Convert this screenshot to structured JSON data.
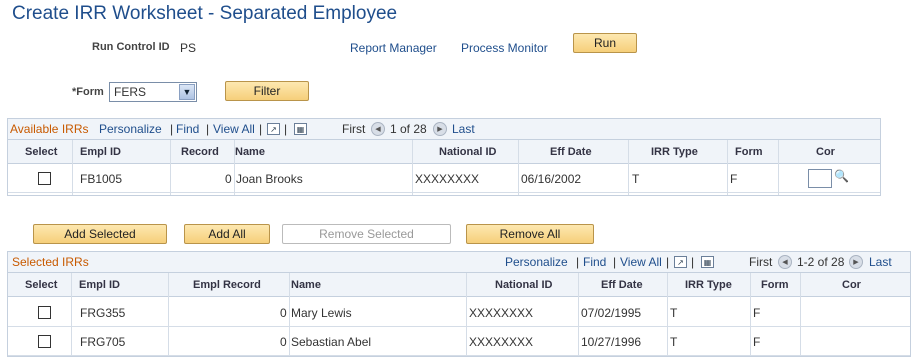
{
  "page": {
    "title": "Create IRR Worksheet - Separated Employee"
  },
  "run_control": {
    "label": "Run Control ID",
    "value": "PS",
    "report_manager": "Report Manager",
    "process_monitor": "Process Monitor",
    "run_label": "Run"
  },
  "form_filter": {
    "label": "*Form",
    "selected": "FERS",
    "filter_label": "Filter"
  },
  "available": {
    "title": "Available IRRs",
    "personalize": "Personalize",
    "find": "Find",
    "view_all": "View All",
    "sep": "|",
    "first": "First",
    "range": "1 of 28",
    "last": "Last",
    "columns": [
      "Select",
      "Empl ID",
      "Record",
      "Name",
      "National ID",
      "Eff Date",
      "IRR Type",
      "Form",
      "Cor"
    ],
    "rows": [
      {
        "empl_id": "FB1005",
        "record": "0",
        "name": "Joan Brooks",
        "national_id": "XXXXXXXX",
        "eff_date": "06/16/2002",
        "irr_type": "T",
        "form": "F"
      }
    ]
  },
  "actions": {
    "add_selected": "Add Selected",
    "add_all": "Add All",
    "remove_selected": "Remove Selected",
    "remove_all": "Remove All"
  },
  "selected": {
    "title": "Selected IRRs",
    "personalize": "Personalize",
    "find": "Find",
    "view_all": "View All",
    "sep": "|",
    "first": "First",
    "range": "1-2 of 28",
    "last": "Last",
    "columns": [
      "Select",
      "Empl ID",
      "Empl Record",
      "Name",
      "National ID",
      "Eff Date",
      "IRR Type",
      "Form",
      "Cor"
    ],
    "rows": [
      {
        "empl_id": "FRG355",
        "record": "0",
        "name": "Mary Lewis",
        "national_id": "XXXXXXXX",
        "eff_date": "07/02/1995",
        "irr_type": "T",
        "form": "F"
      },
      {
        "empl_id": "FRG705",
        "record": "0",
        "name": "Sebastian Abel",
        "national_id": "XXXXXXXX",
        "eff_date": "10/27/1996",
        "irr_type": "T",
        "form": "F"
      }
    ]
  }
}
